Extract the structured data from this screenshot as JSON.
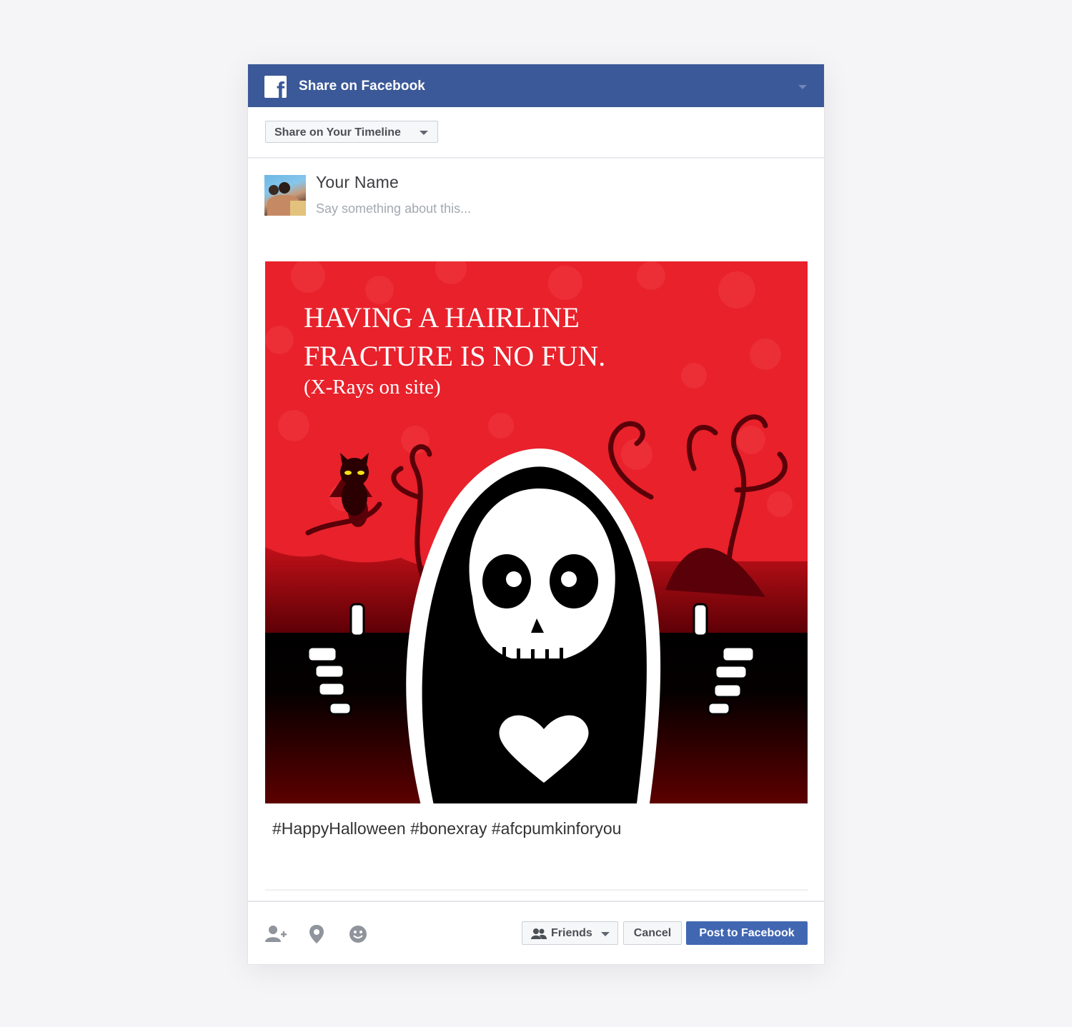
{
  "header": {
    "title": "Share on Facebook",
    "logo_letter": "f"
  },
  "toolbar": {
    "share_target": "Share on Your Timeline"
  },
  "composer": {
    "user_name": "Your Name",
    "placeholder": "Say something about this..."
  },
  "post": {
    "image_headline_line1": "HAVING A HAIRLINE",
    "image_headline_line2": "FRACTURE IS NO FUN.",
    "image_subtitle": "(X-Rays on site)",
    "caption": "#HappyHalloween #bonexray #afcpumkinforyou"
  },
  "footer": {
    "audience_label": "Friends",
    "cancel_label": "Cancel",
    "post_label": "Post to Facebook"
  },
  "colors": {
    "facebook_blue": "#3b5998",
    "post_button": "#4267b2",
    "image_red": "#e8212b",
    "image_dark": "#5a0000"
  },
  "icons": [
    "facebook-logo-icon",
    "chevron-down-icon",
    "tag-friends-icon",
    "location-pin-icon",
    "feeling-smiley-icon",
    "friends-audience-icon"
  ]
}
